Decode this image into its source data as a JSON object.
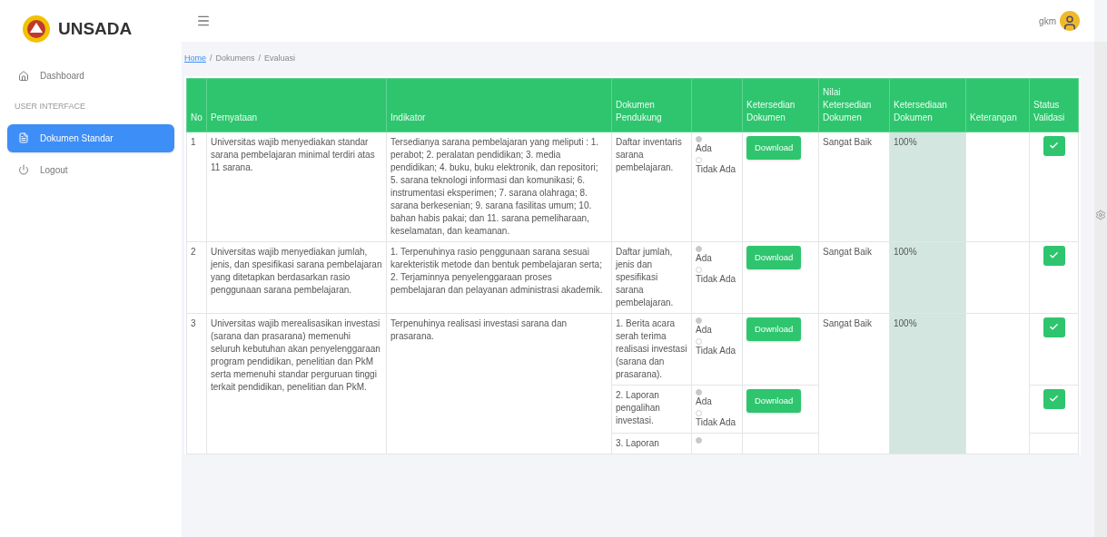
{
  "sidebar": {
    "brand": "UNSADA",
    "items": [
      {
        "kind": "link",
        "label": "Dashboard",
        "selected": false
      },
      {
        "kind": "section",
        "label": "USER INTERFACE"
      },
      {
        "kind": "link",
        "label": "Dokumen Standar",
        "selected": true
      },
      {
        "kind": "link",
        "label": "Logout",
        "selected": false
      }
    ]
  },
  "topbar": {
    "user": "gkm"
  },
  "breadcrumb": [
    {
      "label": "Home",
      "link": true
    },
    {
      "separator": "/"
    },
    {
      "label": "Dokumens",
      "link": false
    },
    {
      "separator": "/"
    },
    {
      "label": "Evaluasi",
      "link": false
    }
  ],
  "table": {
    "columns": [
      {
        "label": "No"
      },
      {
        "label": "Pernyataan"
      },
      {
        "label": "Indikator"
      },
      {
        "label": "Dokumen Pendukung"
      },
      {},
      {
        "label": "Ketersedian Dokumen"
      },
      {
        "label": "Nilai Ketersedian Dokumen"
      },
      {
        "label": "Ketersediaan Dokumen"
      },
      {
        "label": "Keterangan"
      },
      {
        "label": "Status Validasi"
      }
    ],
    "rows": [
      {
        "no": "1",
        "statement": "Universitas wajib menyediakan standar sarana pembelajaran minimal terdiri atas 11 sarana.",
        "indicator": "Tersedianya sarana pembelajaran yang meliputi : 1. perabot; 2. peralatan pendidikan; 3. media pendidikan; 4. buku, buku elektronik, dan repositori; 5. sarana teknologi informasi dan komunikasi; 6. instrumentasi eksperimen; 7. sarana olahraga; 8. sarana berkesenian; 9. sarana fasilitas umum; 10. bahan habis pakai; dan 11. sarana pemeliharaan, keselamatan, dan keamanan.",
        "rating": "Sangat Baik",
        "percent": "100%",
        "docs": [
          {
            "text": "Daftar inventaris sarana pembelajaran.",
            "options": [
              {
                "label": "Ada",
                "selected": true
              },
              {
                "label": "Tidak Ada",
                "selected": false
              }
            ],
            "button": "Download",
            "validated": true
          }
        ]
      },
      {
        "no": "2",
        "statement": "Universitas wajib menyediakan jumlah, jenis, dan spesifikasi sarana pembelajaran yang ditetapkan berdasarkan rasio penggunaan sarana pembelajaran.",
        "indicator": "1. Terpenuhinya rasio penggunaan sarana sesuai karekteristik metode dan bentuk pembelajaran serta; 2. Terjaminnya penyelenggaraan proses pembelajaran dan pelayanan administrasi akademik.",
        "rating": "Sangat Baik",
        "percent": "100%",
        "docs": [
          {
            "text": "Daftar jumlah, jenis dan spesifikasi sarana pembelajaran.",
            "options": [
              {
                "label": "Ada",
                "selected": true
              },
              {
                "label": "Tidak Ada",
                "selected": false
              }
            ],
            "button": "Download",
            "validated": true
          }
        ]
      },
      {
        "no": "3",
        "statement": "Universitas wajib merealisasikan investasi (sarana dan prasarana) memenuhi seluruh kebutuhan akan penyelenggaraan program pendidikan, penelitian dan PkM serta memenuhi standar perguruan tinggi terkait pendidikan, penelitian dan PkM.",
        "indicator": "Terpenuhinya realisasi investasi sarana dan prasarana.",
        "rating": "Sangat Baik",
        "percent": "100%",
        "docs": [
          {
            "text": "1. Berita acara serah terima realisasi investasi (sarana dan prasarana).",
            "options": [
              {
                "label": "Ada",
                "selected": true
              },
              {
                "label": "Tidak Ada",
                "selected": false
              }
            ],
            "button": "Download",
            "validated": true
          },
          {
            "text": "2. Laporan pengalihan investasi.",
            "options": [
              {
                "label": "Ada",
                "selected": true
              },
              {
                "label": "Tidak Ada",
                "selected": false
              }
            ],
            "button": "Download",
            "validated": true
          },
          {
            "text": "3. Laporan",
            "options": [
              {
                "selected": true
              }
            ]
          }
        ]
      }
    ]
  }
}
